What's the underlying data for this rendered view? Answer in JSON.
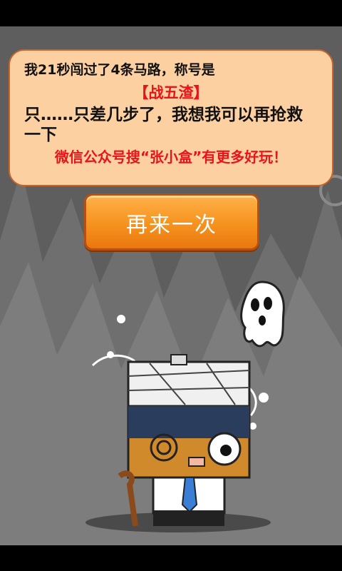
{
  "result": {
    "line1": "我21秒闯过了4条马路，称号是",
    "title": "【战五渣】",
    "line3": "只……只差几步了，我想我可以再抢救",
    "line4": "一下",
    "promo": "微信公众号搜“张小盒”有更多好玩！"
  },
  "retry_button": {
    "label": "再来一次"
  },
  "colors": {
    "panel_bg": "#fdd0a2",
    "panel_border": "#c8652a",
    "title_red": "#e8141b",
    "button_orange": "#f6921e",
    "stage_gray": "#5e5e5e"
  }
}
